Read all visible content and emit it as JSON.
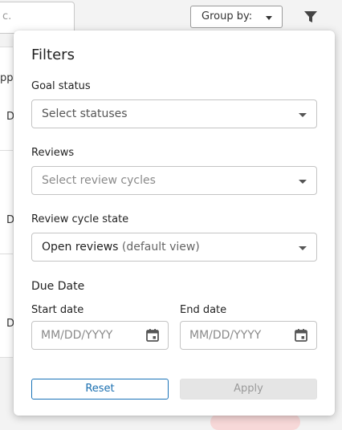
{
  "background": {
    "search_fragment": "c.",
    "group_by_label": "Group by:",
    "row_fragments": [
      "ppo",
      "D",
      "D",
      "D"
    ]
  },
  "filters": {
    "title": "Filters",
    "goal_status": {
      "label": "Goal status",
      "placeholder": "Select statuses"
    },
    "reviews": {
      "label": "Reviews",
      "placeholder": "Select review cycles"
    },
    "review_cycle_state": {
      "label": "Review cycle state",
      "value": "Open reviews",
      "value_note": "(default view)"
    },
    "due_date": {
      "heading": "Due Date",
      "start_label": "Start date",
      "start_placeholder": "MM/DD/YYYY",
      "end_label": "End date",
      "end_placeholder": "MM/DD/YYYY"
    },
    "reset_label": "Reset",
    "apply_label": "Apply"
  }
}
